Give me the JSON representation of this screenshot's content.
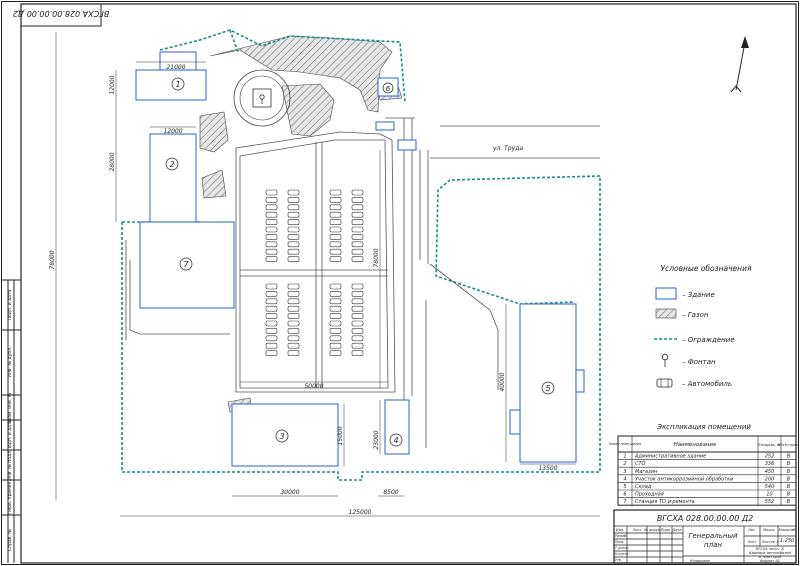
{
  "stamp_top": "ВГСХА 028.00.00.00 Д2",
  "street": "ул. Труда",
  "buildings": [
    {
      "num": "1"
    },
    {
      "num": "2"
    },
    {
      "num": "3"
    },
    {
      "num": "4"
    },
    {
      "num": "5"
    },
    {
      "num": "6"
    },
    {
      "num": "7"
    }
  ],
  "dimensions": {
    "d_21000": "21000",
    "d_12000_a": "12000",
    "d_12000_b": "12000",
    "d_28000": "28000",
    "d_78000": "78000",
    "d_78000v": "78000",
    "d_50000": "50000",
    "d_40000": "40000",
    "d_15000": "15000",
    "d_30000": "30000",
    "d_15000v": "15000",
    "d_23000": "23000",
    "d_8500": "8500",
    "d_125000": "125000",
    "d_13500": "13500"
  },
  "legend": {
    "title": "Условные обозначения",
    "items": [
      "– Здание",
      "– Газон",
      "– Ограждение",
      "– Фонтан",
      "– Автомобиль"
    ]
  },
  "explication": {
    "title": "Экспликация помещений",
    "headers": [
      "Номер поме-щения",
      "Наименование",
      "Площадь, м²",
      "Кате-гория"
    ],
    "rows": [
      [
        "1",
        "Административное здание",
        "252",
        "В"
      ],
      [
        "2",
        "СТО",
        "336",
        "В"
      ],
      [
        "3",
        "Магазин",
        "450",
        "В"
      ],
      [
        "4",
        "Участок антикоррозийной обработки",
        "200",
        "В"
      ],
      [
        "5",
        "Склад",
        "540",
        "В"
      ],
      [
        "6",
        "Проходная",
        "10",
        "В"
      ],
      [
        "7",
        "Станция ТО и ремонта",
        "552",
        "В"
      ]
    ]
  },
  "title_block": {
    "code": "ВГСХА 028.00.00.00 Д2",
    "name_line1": "Генеральный",
    "name_line2": "план",
    "col_labels": [
      "Изм.",
      "Лист",
      "№ докум.",
      "Подп.",
      "Дата"
    ],
    "row_labels": [
      "Разраб.",
      "Пров.",
      "Т.контр.",
      "Н.контр.",
      "Утв."
    ],
    "lit": "Лит.",
    "mass": "Масса",
    "scale_label": "Масштаб",
    "scale": "1:250",
    "sheet": "Лист",
    "sheets": "Листов 1",
    "org1": "ВГСХА лесуч. Б",
    "org2": "Кафедра автомобилей",
    "org3": "и тракторов",
    "copied": "Копировал",
    "format": "Формат А1"
  },
  "side_labels": [
    "Подп. и дата",
    "Инв. № дубл.",
    "Взам. инв. №",
    "Подп. и дата",
    "Инв. № подл.",
    "Перв. примен.",
    "Справ. №"
  ]
}
